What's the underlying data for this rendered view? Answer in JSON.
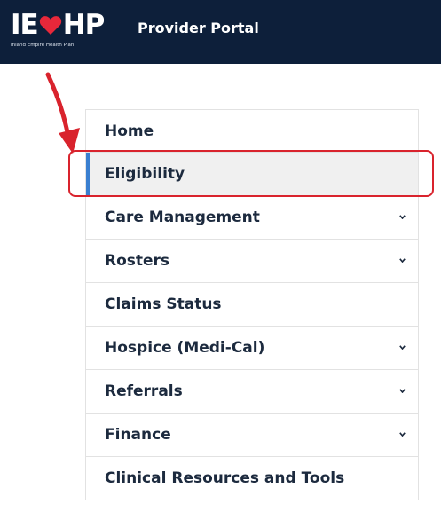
{
  "header": {
    "logo_text_left": "IE",
    "logo_text_right": "HP",
    "logo_subtitle": "Inland Empire Health Plan",
    "portal_title": "Provider Portal"
  },
  "colors": {
    "header_bg": "#0d1f3a",
    "logo_heart": "#e8283a",
    "active_indicator": "#3a7fd0",
    "callout_red": "#d9232d",
    "menu_text": "#1c2a3e"
  },
  "menu": {
    "items": [
      {
        "label": "Home",
        "has_submenu": false,
        "active": false
      },
      {
        "label": "Eligibility",
        "has_submenu": false,
        "active": true
      },
      {
        "label": "Care Management",
        "has_submenu": true,
        "active": false
      },
      {
        "label": "Rosters",
        "has_submenu": true,
        "active": false
      },
      {
        "label": "Claims Status",
        "has_submenu": false,
        "active": false
      },
      {
        "label": "Hospice (Medi-Cal)",
        "has_submenu": true,
        "active": false
      },
      {
        "label": "Referrals",
        "has_submenu": true,
        "active": false
      },
      {
        "label": "Finance",
        "has_submenu": true,
        "active": false
      },
      {
        "label": "Clinical Resources and Tools",
        "has_submenu": false,
        "active": false
      }
    ]
  },
  "annotation": {
    "highlighted_item": "Eligibility",
    "arrow_icon": "red-arrow-icon"
  }
}
